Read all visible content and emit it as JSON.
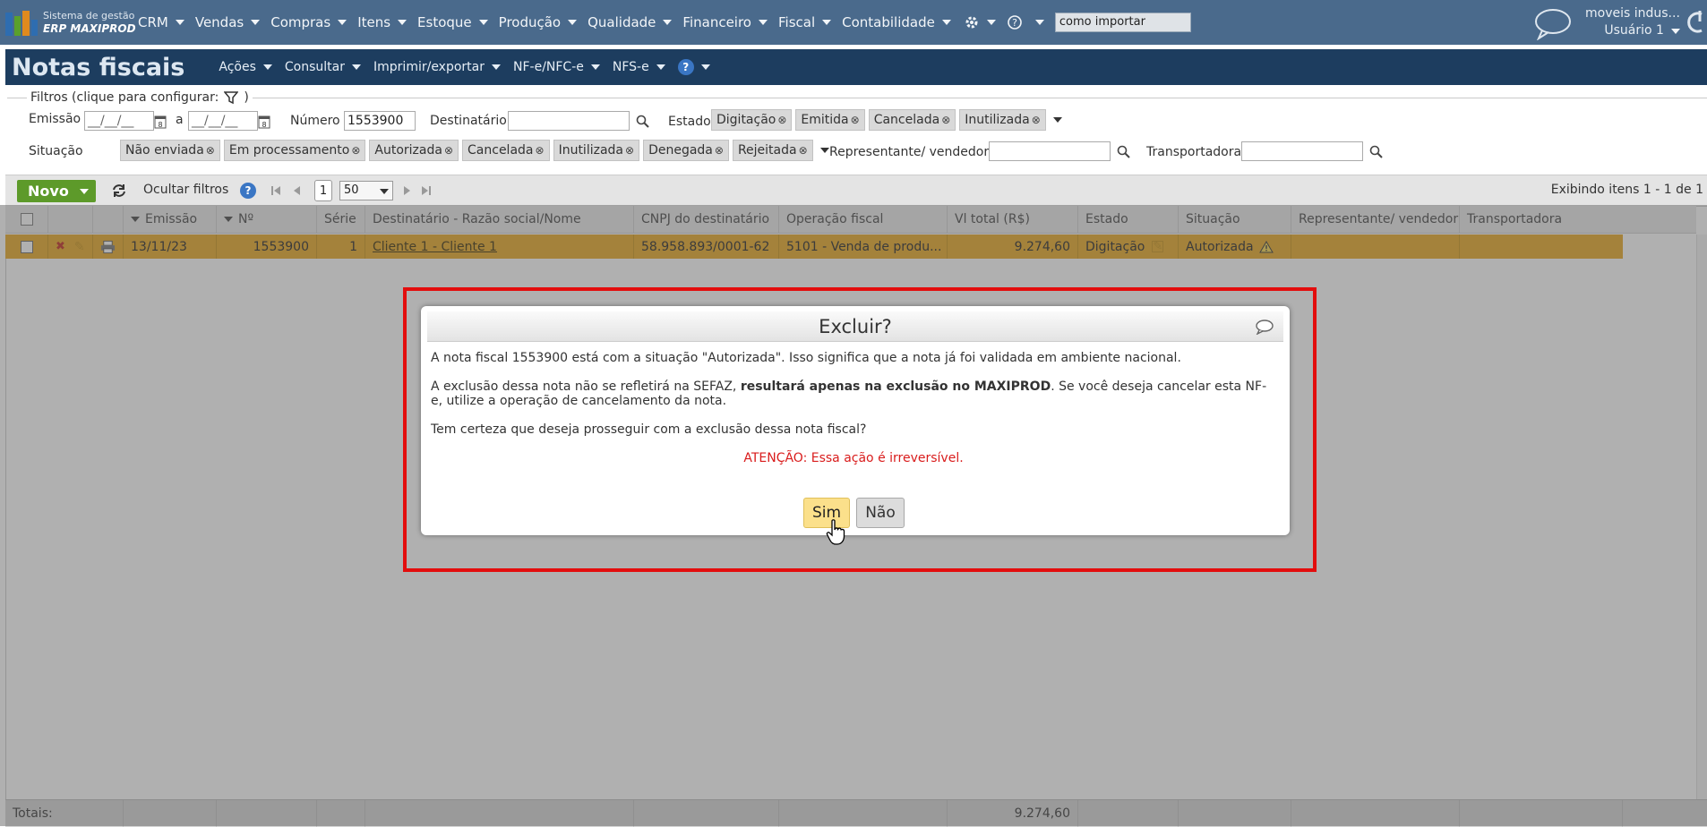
{
  "topnav": {
    "logo_line1": "Sistema de gestão",
    "logo_line2": "ERP MAXIPROD",
    "menus": [
      "CRM",
      "Vendas",
      "Compras",
      "Itens",
      "Estoque",
      "Produção",
      "Qualidade",
      "Financeiro",
      "Fiscal",
      "Contabilidade"
    ],
    "search_value": "como importar",
    "company": "moveis indus...",
    "user": "Usuário 1",
    "colors": {
      "bar": "#4a6a8c",
      "logo_blue": "#2e6db0",
      "logo_green": "#5aa02c",
      "logo_orange": "#e08a1e"
    }
  },
  "titlebar": {
    "title": "Notas fiscais",
    "menus": [
      "Ações",
      "Consultar",
      "Imprimir/exportar",
      "NF-e/NFC-e",
      "NFS-e"
    ],
    "help": "?"
  },
  "filters": {
    "legend": "Filtros (clique para configurar:",
    "legend_close": ")",
    "emissao_label": "Emissão",
    "date_from": "__/__/__",
    "date_sep": "a",
    "date_to": "__/__/__",
    "numero_label": "Número",
    "numero_value": "1553900",
    "destinatario_label": "Destinatário",
    "estado_label": "Estado",
    "estado_chips": [
      "Digitação",
      "Emitida",
      "Cancelada",
      "Inutilizada"
    ],
    "situacao_label": "Situação",
    "situacao_chips": [
      "Não enviada",
      "Em processamento",
      "Autorizada",
      "Cancelada",
      "Inutilizada",
      "Denegada",
      "Rejeitada"
    ],
    "representante_label": "Representante/ vendedor",
    "transportadora_label": "Transportadora"
  },
  "toolbar": {
    "novo": "Novo",
    "ocultar": "Ocultar filtros",
    "page": "1",
    "page_size": "50",
    "summary": "Exibindo itens 1 - 1 de 1"
  },
  "grid": {
    "headers": {
      "emissao": "Emissão",
      "numero": "Nº",
      "serie": "Série",
      "destinatario": "Destinatário - Razão social/Nome",
      "cnpj": "CNPJ do destinatário",
      "operacao": "Operação fiscal",
      "vltotal": "Vl total (R$)",
      "estado": "Estado",
      "situacao": "Situação",
      "representante": "Representante/ vendedor",
      "transportadora": "Transportadora"
    },
    "row": {
      "emissao": "13/11/23",
      "numero": "1553900",
      "serie": "1",
      "destinatario": "Cliente 1 - Cliente 1",
      "cnpj": "58.958.893/0001-62",
      "operacao": "5101 - Venda de produ...",
      "vltotal": "9.274,60",
      "estado": "Digitação",
      "situacao": "Autorizada"
    },
    "row_color": "#e8a820",
    "totals_label": "Totais:",
    "totals_value": "9.274,60"
  },
  "dialog": {
    "title": "Excluir?",
    "p1": "A nota fiscal 1553900 está com a situação \"Autorizada\". Isso significa que a nota já foi validada em ambiente nacional.",
    "p2_before": "A exclusão dessa nota não se refletirá na SEFAZ, ",
    "p2_bold": "resultará apenas na exclusão no MAXIPROD",
    "p2_after": ". Se você deseja cancelar esta NF-e, utilize a operação de cancelamento da nota.",
    "p3": "Tem certeza que deseja prosseguir com a exclusão dessa nota fiscal?",
    "warning": "ATENÇÃO: Essa ação é irreversível.",
    "yes": "Sim",
    "no": "Não",
    "highlight_color": "#e30d0d"
  }
}
